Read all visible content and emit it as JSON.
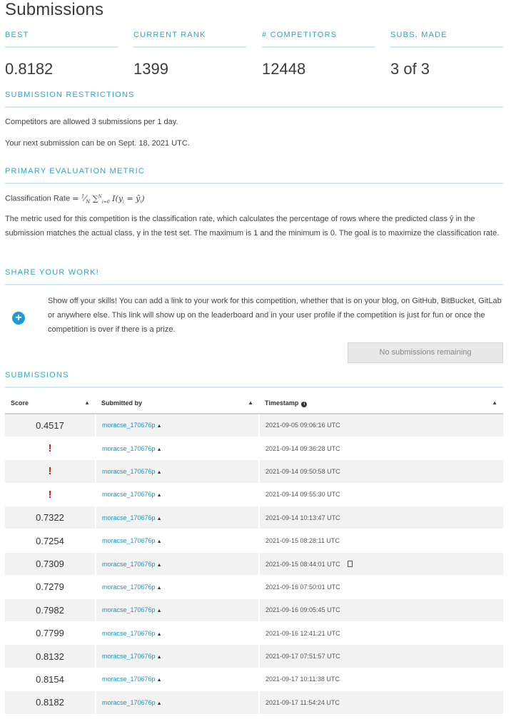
{
  "title": "Submissions",
  "stats": [
    {
      "label": "BEST",
      "value": "0.8182"
    },
    {
      "label": "CURRENT RANK",
      "value": "1399"
    },
    {
      "label": "# COMPETITORS",
      "value": "12448"
    },
    {
      "label": "SUBS. MADE",
      "value": "3 of 3"
    }
  ],
  "restrictions": {
    "heading": "SUBMISSION RESTRICTIONS",
    "line1": "Competitors are allowed 3 submissions per 1 day.",
    "line2": "Your next submission can be on Sept. 18, 2021 UTC."
  },
  "metric": {
    "heading": "PRIMARY EVALUATION METRIC",
    "formula_label": "Classification Rate",
    "description": "The metric used for this competition is the classification rate, which calculates the percentage of rows where the predicted class ŷ in the submission matches the actual class, y in the test set. The maximum is 1 and the minimum is 0. The goal is to maximize the classification rate."
  },
  "share": {
    "heading": "SHARE YOUR WORK!",
    "text": "Show off your skills! You can add a link to your work for this competition, whether that is on your blog, on GitHub, BitBucket, GitLab or anywhere else. This link will show up on the leaderboard and in your user profile if the competition is just for fun or once the competition is over if there is a prize.",
    "button": "No submissions remaining"
  },
  "submissions": {
    "heading": "SUBMISSIONS",
    "columns": [
      "Score",
      "Submitted by",
      "Timestamp"
    ],
    "rows": [
      {
        "score": "0.4517",
        "error": false,
        "user": "moracse_170676p",
        "timestamp": "2021-09-05 09:06:16 UTC",
        "doc": false
      },
      {
        "score": "",
        "error": true,
        "user": "moracse_170676p",
        "timestamp": "2021-09-14 09:36:28 UTC",
        "doc": false
      },
      {
        "score": "",
        "error": true,
        "user": "moracse_170676p",
        "timestamp": "2021-09-14 09:50:58 UTC",
        "doc": false
      },
      {
        "score": "",
        "error": true,
        "user": "moracse_170676p",
        "timestamp": "2021-09-14 09:55:30 UTC",
        "doc": false
      },
      {
        "score": "0.7322",
        "error": false,
        "user": "moracse_170676p",
        "timestamp": "2021-09-14 10:13:47 UTC",
        "doc": false
      },
      {
        "score": "0.7254",
        "error": false,
        "user": "moracse_170676p",
        "timestamp": "2021-09-15 08:28:11 UTC",
        "doc": false
      },
      {
        "score": "0.7309",
        "error": false,
        "user": "moracse_170676p",
        "timestamp": "2021-09-15 08:44:01 UTC",
        "doc": true
      },
      {
        "score": "0.7279",
        "error": false,
        "user": "moracse_170676p",
        "timestamp": "2021-09-16 07:50:01 UTC",
        "doc": false
      },
      {
        "score": "0.7982",
        "error": false,
        "user": "moracse_170676p",
        "timestamp": "2021-09-16 09:05:45 UTC",
        "doc": false
      },
      {
        "score": "0.7799",
        "error": false,
        "user": "moracse_170676p",
        "timestamp": "2021-09-16 12:41:21 UTC",
        "doc": false
      },
      {
        "score": "0.8132",
        "error": false,
        "user": "moracse_170676p",
        "timestamp": "2021-09-17 07:51:57 UTC",
        "doc": false
      },
      {
        "score": "0.8154",
        "error": false,
        "user": "moracse_170676p",
        "timestamp": "2021-09-17 10:11:38 UTC",
        "doc": false
      },
      {
        "score": "0.8182",
        "error": false,
        "user": "moracse_170676p",
        "timestamp": "2021-09-17 11:54:24 UTC",
        "doc": false
      }
    ]
  }
}
